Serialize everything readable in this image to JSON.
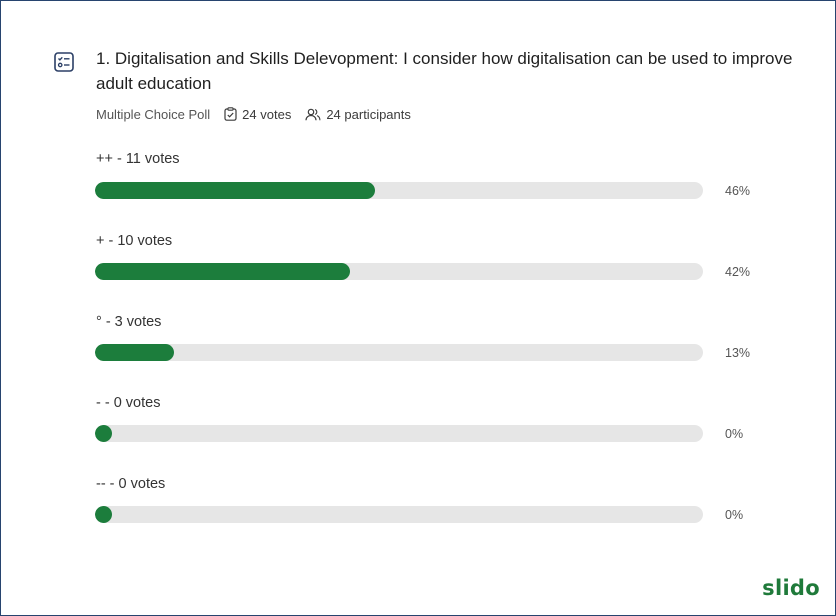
{
  "poll": {
    "title": "1. Digitalisation and Skills Delevopment: I consider how digitalisation can be used to improve adult education",
    "type": "Multiple Choice Poll",
    "votes": "24 votes",
    "participants": "24 participants",
    "icons": {
      "poll_type": "checklist-icon",
      "votes": "clipboard-check-icon",
      "participants": "people-icon"
    }
  },
  "options": [
    {
      "label": "++ - 11 votes",
      "percent_text": "46%",
      "fraction": 0.46
    },
    {
      "label": "+ - 10 votes",
      "percent_text": "42%",
      "fraction": 0.42
    },
    {
      "label": "° - 3 votes",
      "percent_text": "13%",
      "fraction": 0.13
    },
    {
      "label": "- - 0 votes",
      "percent_text": "0%",
      "fraction": 0
    },
    {
      "label": "-- - 0 votes",
      "percent_text": "0%",
      "fraction": 0
    }
  ],
  "brand": {
    "name": "slido"
  },
  "colors": {
    "bar_fill": "#1c7d3c",
    "bar_track": "#e6e6e6",
    "frame_border": "#27446f",
    "brand": "#1f7a3a"
  }
}
